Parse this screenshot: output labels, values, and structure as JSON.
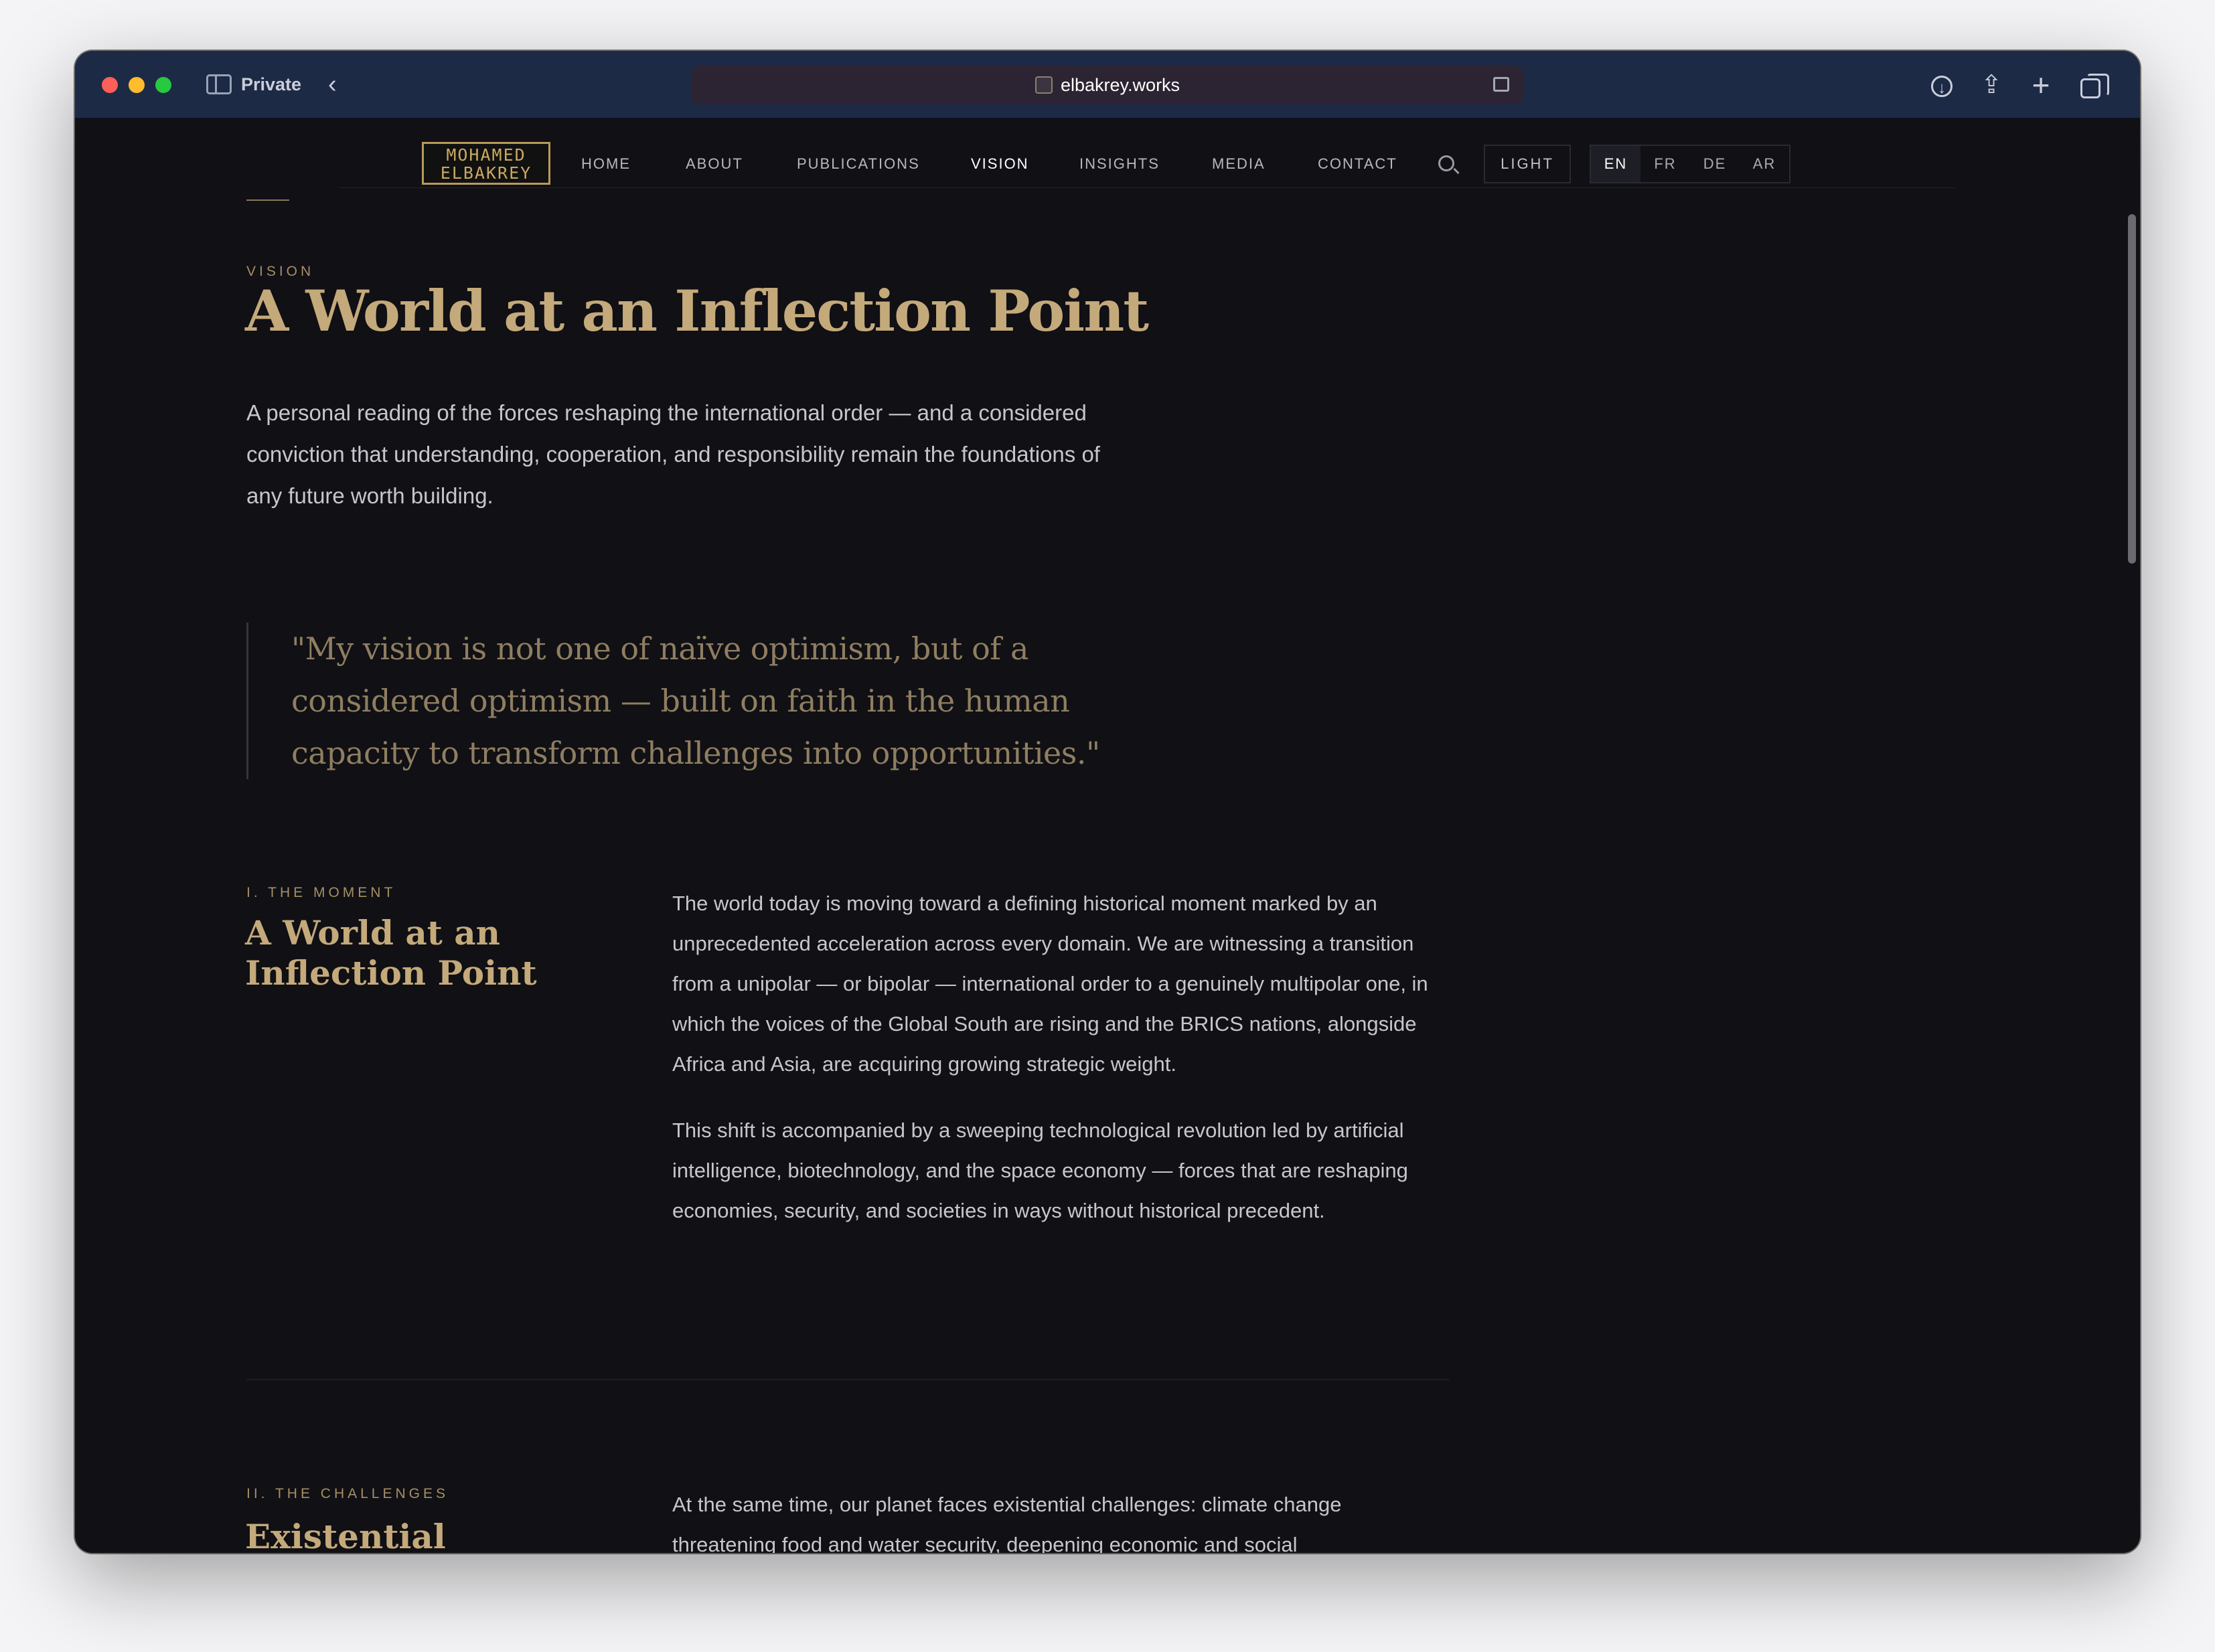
{
  "browser": {
    "mode_label": "Private",
    "url": "elbakrey.works"
  },
  "site": {
    "logo_line1": "MOHAMED",
    "logo_line2": "ELBAKREY",
    "nav": [
      "HOME",
      "ABOUT",
      "PUBLICATIONS",
      "VISION",
      "INSIGHTS",
      "MEDIA",
      "CONTACT"
    ],
    "active_nav": "VISION",
    "theme_toggle": "LIGHT",
    "languages": [
      "EN",
      "FR",
      "DE",
      "AR"
    ],
    "active_language": "EN"
  },
  "hero": {
    "eyebrow": "VISION",
    "title": "A World at an Inflection Point",
    "lead": "A personal reading of the forces reshaping the international order — and a considered conviction that understanding, cooperation, and responsibility remain the foundations of any future worth building."
  },
  "quote": "\"My vision is not one of naïve optimism, but of a considered optimism — built on faith in the human capacity to transform challenges into opportunities.\"",
  "sections": [
    {
      "eyebrow": "I. THE MOMENT",
      "title": "A World at an Inflection Point",
      "paragraphs": [
        "The world today is moving toward a defining historical moment marked by an unprecedented acceleration across every domain. We are witnessing a transition from a unipolar — or bipolar — international order to a genuinely multipolar one, in which the voices of the Global South are rising and the BRICS nations, alongside Africa and Asia, are acquiring growing strategic weight.",
        "This shift is accompanied by a sweeping technological revolution led by artificial intelligence, biotechnology, and the space economy — forces that are reshaping economies, security, and societies in ways without historical precedent."
      ]
    },
    {
      "eyebrow": "II. THE CHALLENGES",
      "title": "Existential Challenges,",
      "paragraphs": [
        "At the same time, our planet faces existential challenges: climate change threatening food and water security, deepening economic and social"
      ]
    }
  ],
  "colors": {
    "chrome": "#1d2a45",
    "page_bg": "#101015",
    "accent_gold": "#c4a97a",
    "body_text": "#c6c6cd"
  }
}
